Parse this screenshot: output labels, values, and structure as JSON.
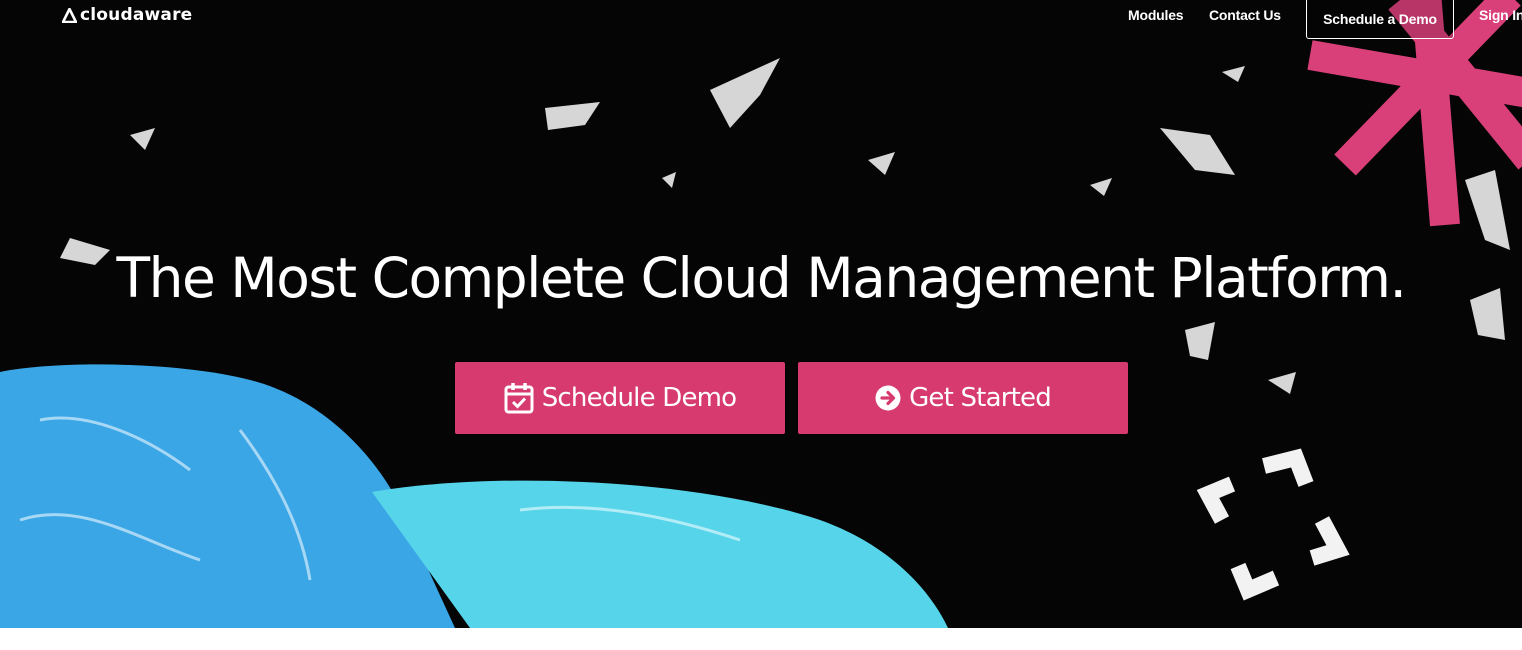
{
  "colors": {
    "background": "#050505",
    "accent_pink": "#d63a6e",
    "shape_blue": "#3aa6e6",
    "shape_cyan": "#55d4ea",
    "star_pink": "#d94079",
    "text": "#ffffff"
  },
  "nav": {
    "logo_text": "cloudaware",
    "logo_icon": "triangle-logo-icon",
    "links": {
      "modules": "Modules",
      "contact": "Contact Us",
      "schedule_demo": "Schedule a Demo",
      "sign_in": "Sign In"
    }
  },
  "hero": {
    "headline": "The Most Complete Cloud Management Platform.",
    "buttons": {
      "schedule": {
        "label": "Schedule Demo",
        "icon": "calendar-check-icon"
      },
      "start": {
        "label": "Get Started",
        "icon": "arrow-circle-right-icon"
      }
    }
  }
}
